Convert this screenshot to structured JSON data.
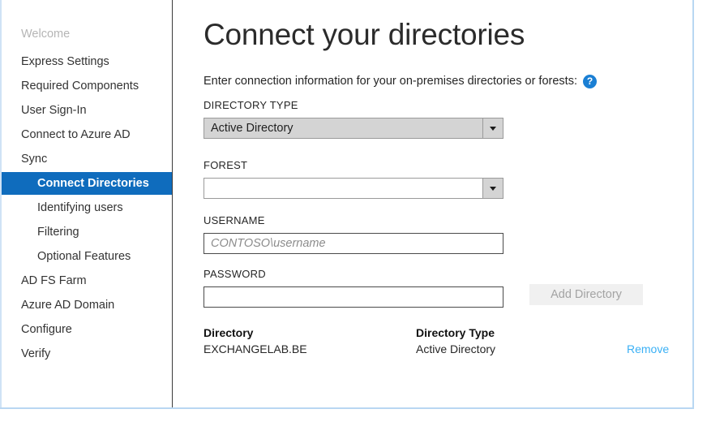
{
  "sidebar": {
    "items": [
      {
        "label": "Welcome",
        "level": "top",
        "state": "done"
      },
      {
        "label": "Express Settings",
        "level": "top",
        "state": "normal"
      },
      {
        "label": "Required Components",
        "level": "top",
        "state": "normal"
      },
      {
        "label": "User Sign-In",
        "level": "top",
        "state": "normal"
      },
      {
        "label": "Connect to Azure AD",
        "level": "top",
        "state": "normal"
      },
      {
        "label": "Sync",
        "level": "top",
        "state": "normal"
      },
      {
        "label": "Connect Directories",
        "level": "sub",
        "state": "active"
      },
      {
        "label": "Identifying users",
        "level": "sub",
        "state": "normal"
      },
      {
        "label": "Filtering",
        "level": "sub",
        "state": "normal"
      },
      {
        "label": "Optional Features",
        "level": "sub",
        "state": "normal"
      },
      {
        "label": "AD FS Farm",
        "level": "top",
        "state": "normal"
      },
      {
        "label": "Azure AD Domain",
        "level": "top",
        "state": "normal"
      },
      {
        "label": "Configure",
        "level": "top",
        "state": "normal"
      },
      {
        "label": "Verify",
        "level": "top",
        "state": "normal"
      }
    ]
  },
  "main": {
    "title": "Connect your directories",
    "subtitle": "Enter connection information for your on-premises directories or forests:",
    "help_icon": "help-icon",
    "fields": {
      "directory_type": {
        "label": "DIRECTORY TYPE",
        "value": "Active Directory"
      },
      "forest": {
        "label": "FOREST",
        "value": ""
      },
      "username": {
        "label": "USERNAME",
        "value": "",
        "placeholder": "CONTOSO\\username"
      },
      "password": {
        "label": "PASSWORD",
        "value": ""
      }
    },
    "add_directory_button": {
      "label": "Add Directory",
      "enabled": false
    },
    "table": {
      "headers": {
        "directory": "Directory",
        "directory_type": "Directory Type",
        "action": ""
      },
      "rows": [
        {
          "directory": "EXCHANGELAB.BE",
          "directory_type": "Active Directory",
          "action": "Remove"
        }
      ]
    }
  },
  "colors": {
    "accent_blue": "#0f6cbd",
    "link_blue": "#3ab0f5",
    "help_blue": "#1a7fd4",
    "disabled_text": "#a3a3a3",
    "window_border": "#b9d7f2"
  }
}
